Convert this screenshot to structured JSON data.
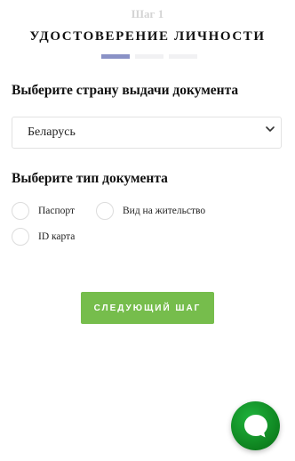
{
  "header": {
    "step": "Шаг 1",
    "title": "УДОСТОВЕРЕНИЕ ЛИЧНОСТИ",
    "progress": {
      "current_step": 1,
      "total_steps": 3
    }
  },
  "country_section": {
    "title": "Выберите страну выдачи документа",
    "selected": "Беларусь",
    "icon": "chevron-down-icon"
  },
  "doc_type_section": {
    "title": "Выберите тип документа",
    "options": [
      {
        "label": "Паспорт",
        "selected": false
      },
      {
        "label": "Вид на жительство",
        "selected": false
      },
      {
        "label": "ID карта",
        "selected": false
      }
    ]
  },
  "actions": {
    "next_label": "СЛЕДУЮЩИЙ ШАГ",
    "next_color": "#76bd4c"
  },
  "chat": {
    "icon": "chat-bubble-icon",
    "color": "#14a02c"
  },
  "colors": {
    "progress_active": "#8a92c6",
    "progress_inactive": "#f1f1f3"
  }
}
